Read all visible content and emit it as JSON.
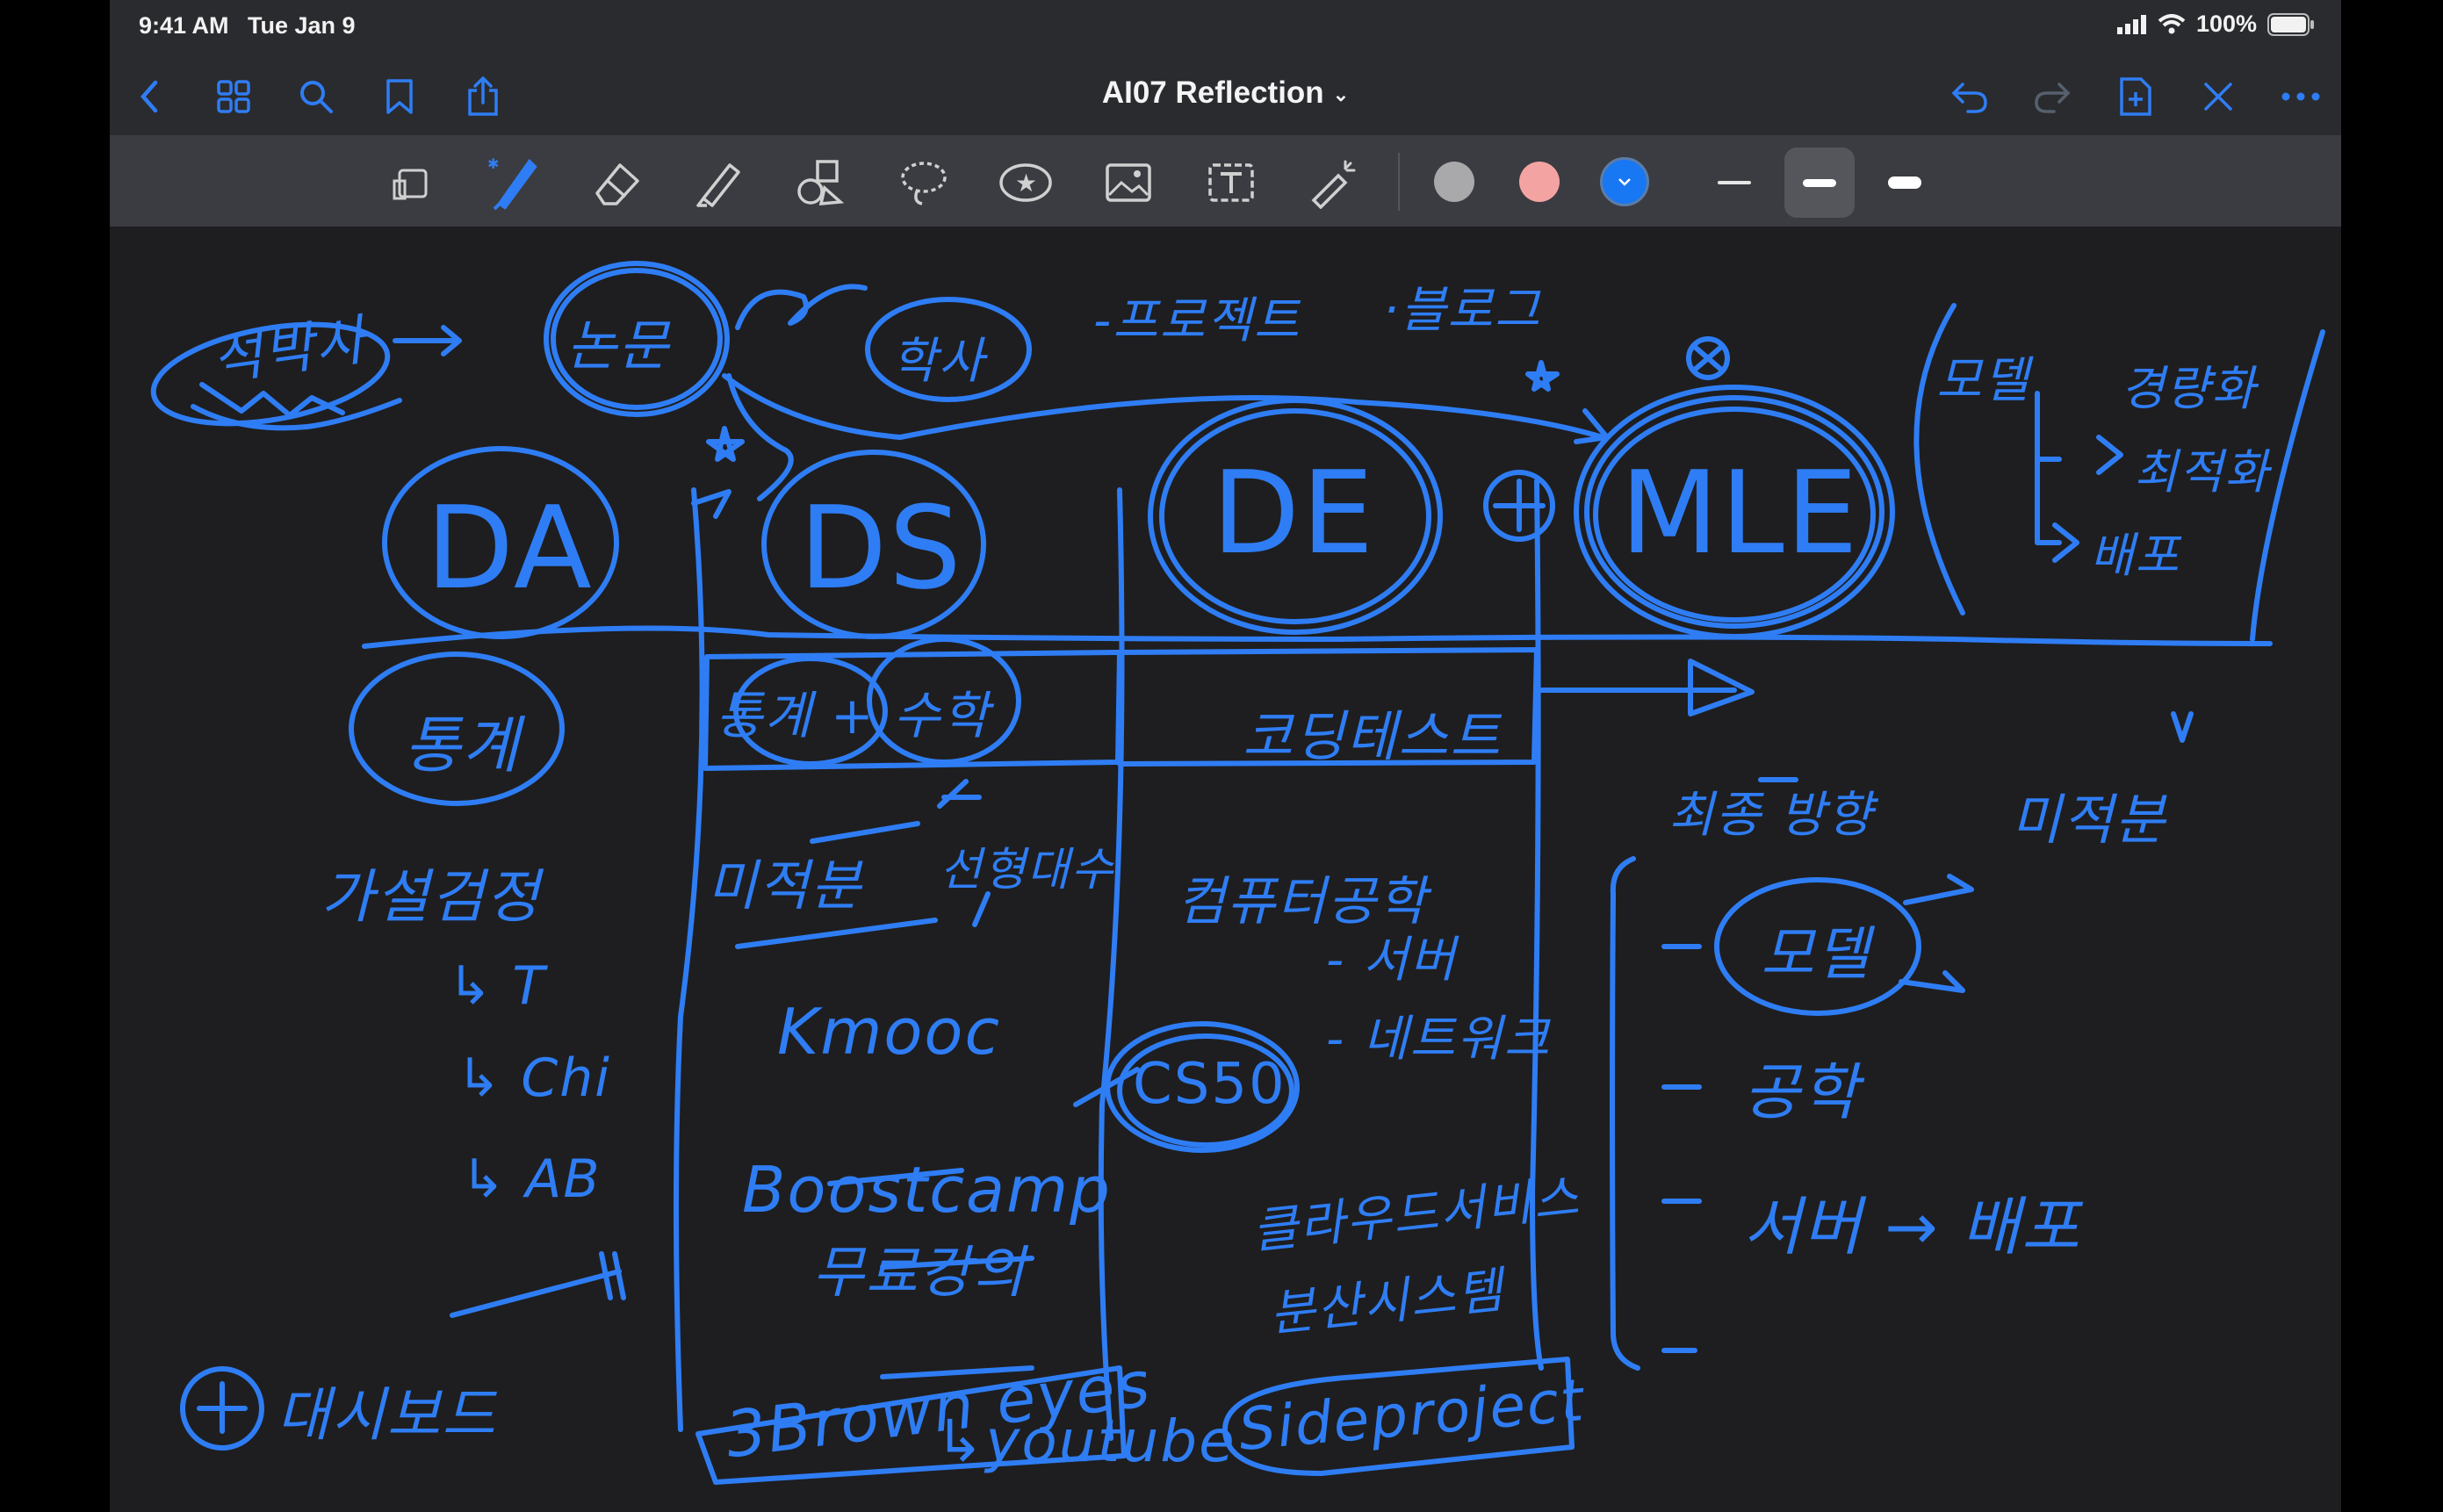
{
  "status_bar": {
    "time": "9:41 AM",
    "date": "Tue Jan 9",
    "battery": "100%"
  },
  "nav": {
    "title": "AI07 Reflection"
  },
  "colors": {
    "ink": "#2f7df4",
    "swatch_gray": "#a9a9ab",
    "swatch_pink": "#f4a3a3",
    "swatch_blue": "#1877f2"
  },
  "canvas": {
    "top_notes": {
      "masters_phd": "석박사",
      "paper": "논문",
      "bachelor": "학사",
      "project": "-프로젝트",
      "blog": "·블로그"
    },
    "roles": {
      "da": "DA",
      "ds": "DS",
      "de": "DE",
      "mle": "MLE"
    },
    "da_column": {
      "statistics": "통계",
      "hypothesis_testing": "가설검정",
      "t": "↳ T",
      "chi": "↳ Chi",
      "ab": "↳ AB",
      "dashboard": "대시보드"
    },
    "ds_column": {
      "stats_math": "통계 + 수학",
      "calculus": "미적분",
      "linear_algebra": "선형대수",
      "kmooc": "Kmooc",
      "boostcamp": "Boostcamp",
      "free_lecture": "무료강의",
      "brown_eyes": "3Brown eyes",
      "youtube": "↳youtube"
    },
    "de_column": {
      "coding_test": "코딩테스트",
      "cs": "컴퓨터공학",
      "server": "- 서버",
      "network": "- 네트워크",
      "cs50": "CS50",
      "cloud": "클라우드서비스",
      "distributed": "분산시스템",
      "side_project": "Sideproject"
    },
    "mle_column": {
      "model": "모델",
      "lightweight": "경량화",
      "optimization": "최적화",
      "deploy": "배포",
      "final_goal": "최종 방향",
      "fine_tune": "미적분",
      "model_big": "모델",
      "engineering": "공학",
      "server_deploy": "서버 → 배포"
    }
  }
}
